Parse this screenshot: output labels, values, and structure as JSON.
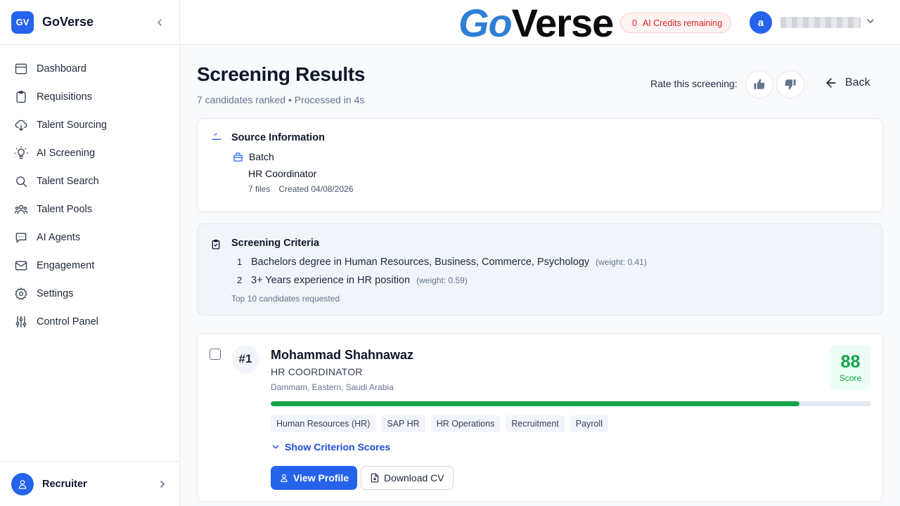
{
  "sidebar": {
    "logo_initials": "GV",
    "brand": "GoVerse",
    "items": [
      {
        "label": "Dashboard",
        "icon": "dashboard-icon"
      },
      {
        "label": "Requisitions",
        "icon": "clipboard-icon"
      },
      {
        "label": "Talent Sourcing",
        "icon": "cloud-download-icon"
      },
      {
        "label": "AI Screening",
        "icon": "lightbulb-icon"
      },
      {
        "label": "Talent Search",
        "icon": "search-icon"
      },
      {
        "label": "Talent Pools",
        "icon": "users-icon"
      },
      {
        "label": "AI Agents",
        "icon": "chat-icon"
      },
      {
        "label": "Engagement",
        "icon": "mail-icon"
      },
      {
        "label": "Settings",
        "icon": "gear-icon"
      },
      {
        "label": "Control Panel",
        "icon": "sliders-icon"
      }
    ],
    "footer_role": "Recruiter"
  },
  "header": {
    "logo_part1": "Go",
    "logo_part2": "Verse",
    "credits_count": "0",
    "credits_label": "AI Credits remaining",
    "user_initial": "a"
  },
  "page": {
    "title": "Screening Results",
    "subtitle": "7 candidates ranked • Processed in 4s",
    "rate_label": "Rate this screening:",
    "back_label": "Back"
  },
  "source": {
    "title": "Source Information",
    "type": "Batch",
    "name": "HR Coordinator",
    "files": "7 files",
    "created": "Created 04/08/2026"
  },
  "criteria": {
    "title": "Screening Criteria",
    "items": [
      {
        "num": "1",
        "text": "Bachelors degree in Human Resources, Business, Commerce, Psychology",
        "weight": "(weight: 0.41)"
      },
      {
        "num": "2",
        "text": "3+ Years experience in HR position",
        "weight": "(weight: 0.59)"
      }
    ],
    "footer": "Top 10 candidates requested"
  },
  "candidate": {
    "rank": "#1",
    "name": "Mohammad Shahnawaz",
    "title": "HR COORDINATOR",
    "location": "Dammam, Eastern, Saudi Arabia",
    "score": "88",
    "score_label": "Score",
    "score_fraction": 0.88,
    "tags": [
      "Human Resources (HR)",
      "SAP HR",
      "HR Operations",
      "Recruitment",
      "Payroll"
    ],
    "show_criteria_label": "Show Criterion Scores",
    "view_profile_label": "View Profile",
    "download_cv_label": "Download CV"
  },
  "colors": {
    "accent": "#2563eb",
    "score_green": "#16a34a",
    "credits_red": "#dc2626"
  }
}
